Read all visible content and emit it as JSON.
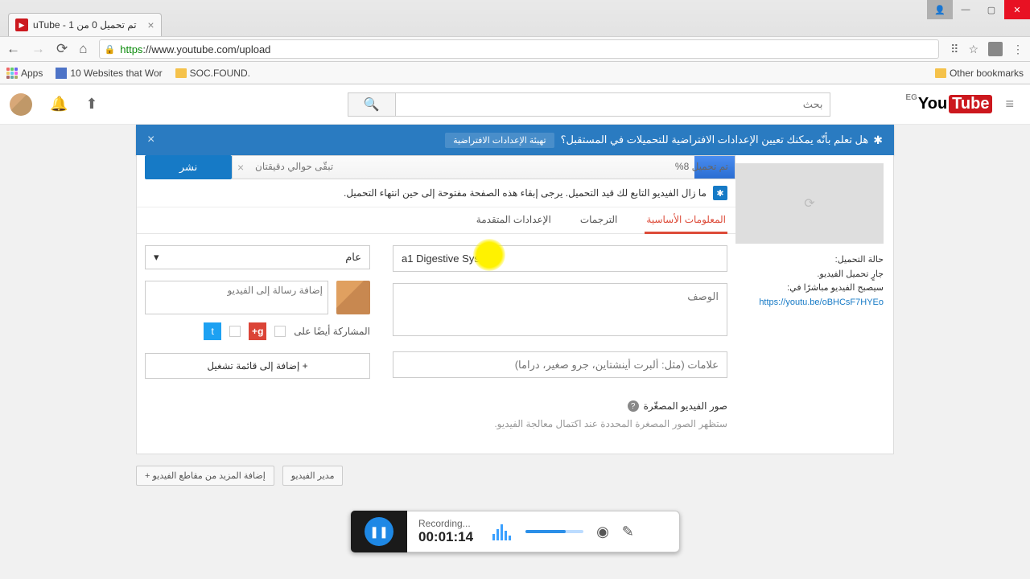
{
  "browser": {
    "tab_title": "uTube - تم تحميل 0 من 1",
    "url_https": "https",
    "url_rest": "://www.youtube.com/upload",
    "apps_label": "Apps",
    "bookmark1": "10 Websites that Wor",
    "bookmark2": "SOC.FOUND.",
    "other_bookmarks": "Other bookmarks"
  },
  "masthead": {
    "search_placeholder": "بحث",
    "logo_eg": "EG",
    "logo_you": "You",
    "logo_tube": "Tube"
  },
  "banner": {
    "text": "هل تعلم بأنّه يمكنك تعيين الإعدادات الافتراضية للتحميلات في المستقبل؟",
    "link": "تهيئة الإعدادات الافتراضية"
  },
  "upload": {
    "publish_label": "نشر",
    "progress_pct": "تم تحميل 8%",
    "eta": "تبقّى حوالي دقيقتان",
    "info_text": "ما زال الفيديو التابع لك قيد التحميل. يرجى إبقاء هذه الصفحة مفتوحة إلى حين انتهاء التحميل.",
    "status_heading": "حالة التحميل:",
    "status_line1": "جارٍ تحميل الفيديو.",
    "status_line2": "سيصبح الفيديو مباشرًا في:",
    "video_url": "https://youtu.be/oBHCsF7HYEo"
  },
  "tabs": {
    "basic": "المعلومات الأساسية",
    "translations": "الترجمات",
    "advanced": "الإعدادات المتقدمة"
  },
  "form": {
    "title_value": "a1 Digestive System",
    "description_placeholder": "الوصف",
    "tags_placeholder": "علامات (مثل: ألبرت أينشتاين، جرو صغير، دراما)",
    "privacy_value": "عام",
    "message_placeholder": "إضافة رسالة إلى الفيديو",
    "share_label": "المشاركة أيضًا على",
    "playlist_label": "+ إضافة إلى قائمة تشغيل"
  },
  "thumbnails": {
    "heading": "صور الفيديو المصغّرة",
    "hint": "ستظهر الصور المصغرة المحددة عند اكتمال معالجة الفيديو."
  },
  "bottom": {
    "manager": "مدير الفيديو",
    "add_more": "إضافة المزيد من مقاطع الفيديو"
  },
  "recorder": {
    "label": "Recording...",
    "time": "00:01:14"
  }
}
